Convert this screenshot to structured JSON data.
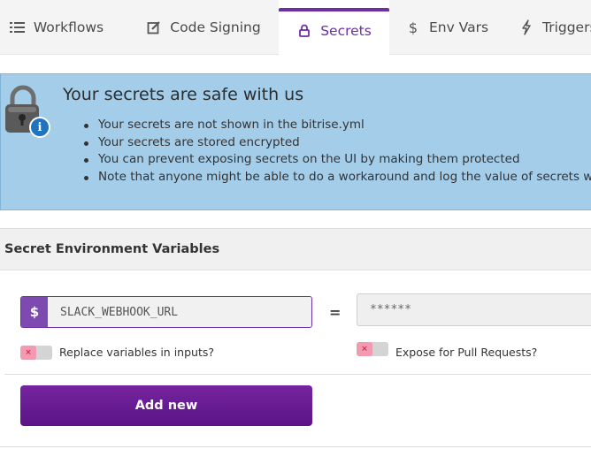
{
  "tabs": [
    {
      "label": "Workflows",
      "icon": "list-icon",
      "active": false
    },
    {
      "label": "Code Signing",
      "icon": "edit-icon",
      "active": false
    },
    {
      "label": "Secrets",
      "icon": "lock-icon",
      "active": true
    },
    {
      "label": "Env Vars",
      "icon": "dollar-icon",
      "active": false
    },
    {
      "label": "Triggers",
      "icon": "bolt-icon",
      "active": false
    }
  ],
  "notice": {
    "title": "Your secrets are safe with us",
    "items": [
      "Your secrets are not shown in the bitrise.yml",
      "Your secrets are stored encrypted",
      "You can prevent exposing secrets on the UI by making them protected",
      "Note that anyone might be able to do a workaround and log the value of secrets with a pu"
    ],
    "info_glyph": "i"
  },
  "section": {
    "title": "Secret Environment Variables"
  },
  "form": {
    "dollar": "$",
    "key_value": "SLACK_WEBHOOK_URL",
    "equals": "=",
    "value_value": "******",
    "toggle_glyph": "×",
    "replace_label": "Replace variables in inputs?",
    "replace_on": false,
    "expose_label": "Expose for Pull Requests?",
    "expose_on": false,
    "add_label": "Add new"
  },
  "colors": {
    "accent": "#6b2fa6",
    "notice_bg": "#a4cdea",
    "button": "#5a1486",
    "toggle_off": "#f29bb0"
  }
}
